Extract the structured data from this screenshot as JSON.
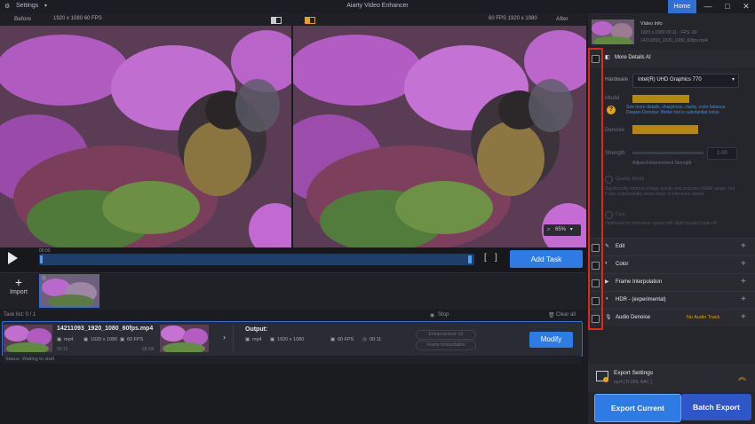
{
  "titlebar": {
    "settings_label": "Settings",
    "app_title": "Aiarty Video Enhancer",
    "home_label": "Home",
    "min_glyph": "—",
    "max_glyph": "□",
    "close_glyph": "✕"
  },
  "preview": {
    "before_label": "Before",
    "before_res": "1920 x 1080 60 FPS",
    "after_res": "60 FPS  1920 x 1080",
    "after_label": "After",
    "zoom": "65%"
  },
  "playback": {
    "time": "00:00",
    "add_task_label": "Add Task",
    "bracket_in": "[",
    "bracket_out": "]"
  },
  "import": {
    "label": "Import"
  },
  "tasklist": {
    "count_label": "Task list: 0 / 1",
    "stop_label": "Stop",
    "clear_label": "Clear all"
  },
  "task": {
    "filename": "14211093_1920_1080_60fps.mp4",
    "src_format": "mp4",
    "src_res": "1920 x 1080",
    "src_fps": "60 FPS",
    "src_time": "00:15",
    "src_size": "58 KB",
    "output_label": "Output:",
    "out_format": "mp4",
    "out_res": "1920 x 1080",
    "out_fps": "60 FPS",
    "out_time": "00:11",
    "chip1": "Enhancement: x2",
    "chip2": "Frame Interpolation",
    "modify_label": "Modify",
    "status": "Status: Waiting to start"
  },
  "rightpanel": {
    "video_info_title": "Video Info",
    "video_info_line1": "1920 x 1080  00:11  ·  FPS: 60",
    "video_info_line2": "14211093_1920_1080_60fps.mp4",
    "more_details_label": "More Details AI",
    "hardware_label": "Hardware",
    "hardware_value": "Intel(R) UHD Graphics 770",
    "model_label": "Model",
    "hint_text": "See more details, sharpness, clarity, color balance. Deeper-Denoise: Better but is substantial noise.",
    "denoise_label": "Denoise",
    "strength_label": "Strength",
    "strength_value": "1.00",
    "strength_caption": "Adjust Enhancement Strength",
    "gray_option1": "Quality Mode",
    "gray_desc1": "Significantly improve image quality and reduces VRAM usage, but it also substantially slows down in inference speed.",
    "gray_option2": "Fast",
    "gray_desc2": "Optimized for inference speed with slight quality trade-off.",
    "sections": [
      {
        "label": "Edit",
        "extra": ""
      },
      {
        "label": "Color",
        "extra": ""
      },
      {
        "label": "Frame Interpolation",
        "extra": ""
      },
      {
        "label": "HDR - (experimental)",
        "extra": ""
      },
      {
        "label": "Audio Denoise",
        "extra": "No Audio Track"
      }
    ],
    "export_settings_label": "Export Settings",
    "export_settings_sub": "mp4 [ H.265, AAC ]",
    "export_current_label": "Export Current",
    "batch_export_label": "Batch Export"
  },
  "colors": {
    "accent": "#2e7be6",
    "highlight": "#e1261c",
    "model_bar": "#b7860f",
    "hint": "#3f8cf0"
  }
}
